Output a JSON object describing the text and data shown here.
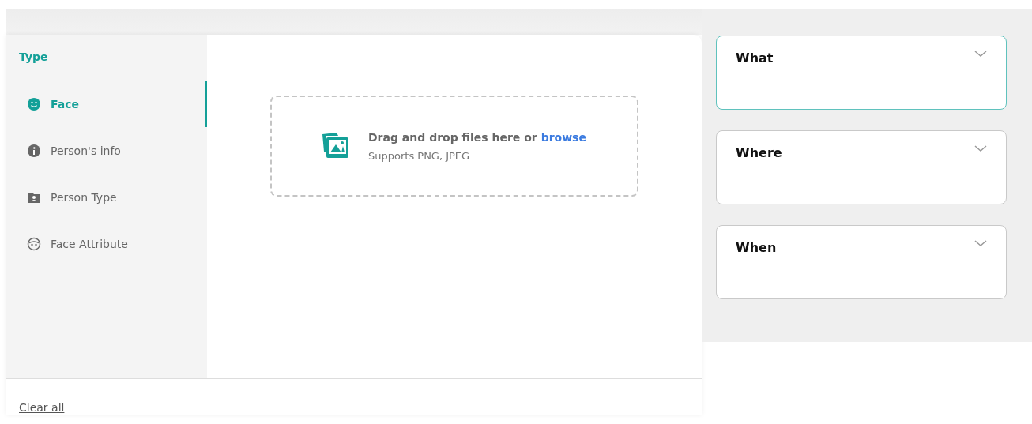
{
  "filter_panel": {
    "heading": "Type",
    "items": [
      {
        "label": "Face",
        "kind": "face",
        "selected": true
      },
      {
        "label": "Person's info",
        "kind": "info",
        "selected": false
      },
      {
        "label": "Person Type",
        "kind": "person-type",
        "selected": false
      },
      {
        "label": "Face Attribute",
        "kind": "face-attribute",
        "selected": false
      }
    ],
    "upload": {
      "prompt": "Drag and drop files here or ",
      "link": "browse",
      "hint": "Supports PNG, JPEG"
    },
    "clear_all": "Clear all"
  },
  "criteria": [
    {
      "label": "What",
      "selected": true
    },
    {
      "label": "Where",
      "selected": false
    },
    {
      "label": "When",
      "selected": false
    }
  ]
}
